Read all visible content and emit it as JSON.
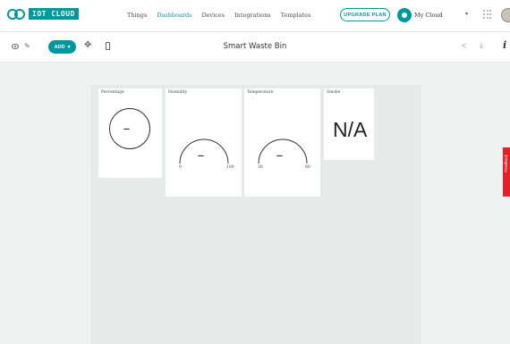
{
  "app": {
    "brand": "IOT CLOUD"
  },
  "nav": {
    "items": [
      "Things",
      "Dashboards",
      "Devices",
      "Integrations",
      "Templates"
    ],
    "active": "Dashboards"
  },
  "header": {
    "upgrade_label": "UPGRADE PLAN",
    "account_label": "My Cloud"
  },
  "toolbar": {
    "add_label": "ADD",
    "dashboard_title": "Smart Waste Bin"
  },
  "widgets": {
    "percentage": {
      "title": "Percentage",
      "value": "---"
    },
    "humidity": {
      "title": "Humidity",
      "value": "---",
      "min": "0",
      "max": "100"
    },
    "temperature": {
      "title": "Temperature",
      "value": "---",
      "min": "30",
      "max": "80"
    },
    "smoke": {
      "title": "Smoke",
      "value": "N/A"
    }
  },
  "feedback": {
    "label": "Feedback"
  },
  "colors": {
    "accent": "#00979d",
    "feedback": "#e5202a",
    "canvas": "#f0f2f1"
  }
}
